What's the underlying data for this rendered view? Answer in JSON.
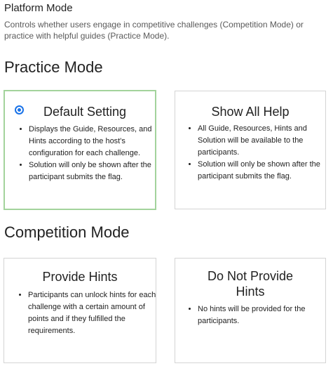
{
  "setting": {
    "title": "Platform Mode",
    "description": "Controls whether users engage in competitive challenges (Competition Mode) or practice with helpful guides (Practice Mode)."
  },
  "practice": {
    "heading": "Practice Mode",
    "cards": [
      {
        "title": "Default Setting",
        "selected": true,
        "bullets": [
          "Displays the Guide, Resources, and Hints according to the host's configuration for each challenge.",
          "Solution will only be shown after the participant submits the flag."
        ]
      },
      {
        "title": "Show All Help",
        "selected": false,
        "bullets": [
          "All Guide, Resources, Hints and Solution will be available to the participants.",
          "Solution will only be shown after the participant submits the flag."
        ]
      }
    ]
  },
  "competition": {
    "heading": "Competition Mode",
    "cards": [
      {
        "title": "Provide Hints",
        "selected": false,
        "bullets": [
          "Participants can unlock hints for each challenge with a certain amount of points and if they fulfilled the requirements."
        ]
      },
      {
        "title": "Do Not Provide Hints",
        "selected": false,
        "bullets": [
          "No hints will be provided for the participants."
        ]
      }
    ]
  },
  "colors": {
    "selected_border": "#a3d39c",
    "radio": "#1a73e8",
    "card_border": "#d4d4d4"
  }
}
